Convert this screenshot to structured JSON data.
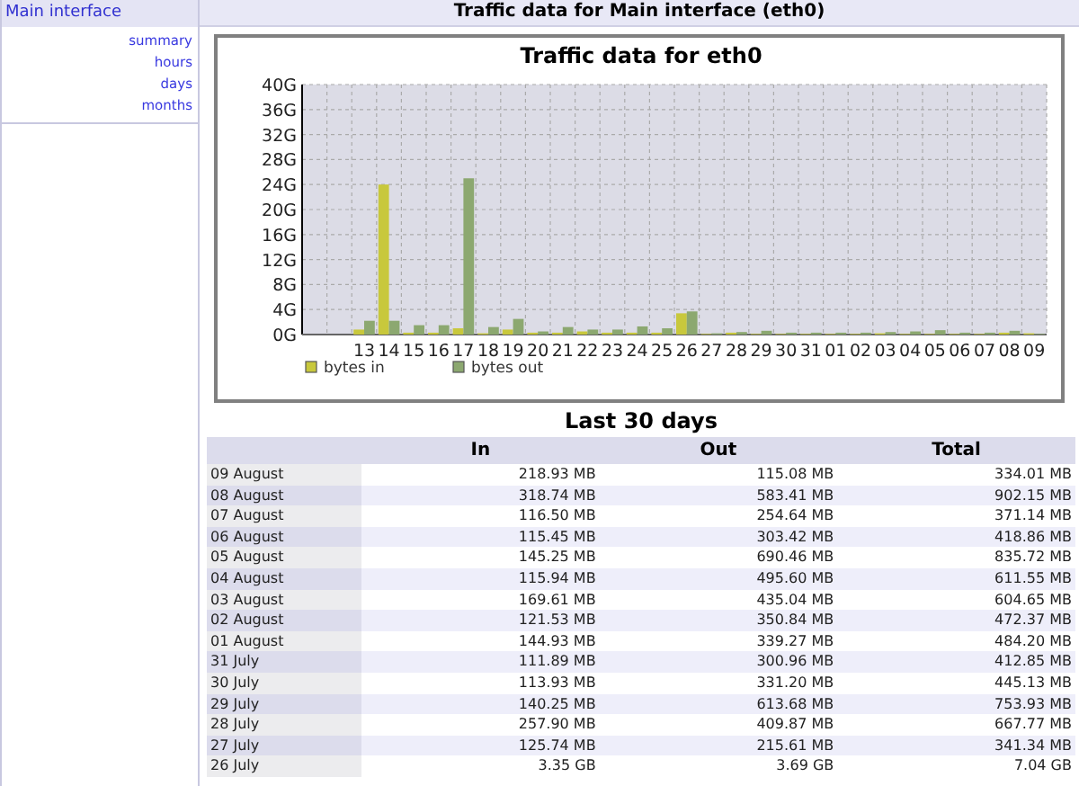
{
  "sidebar": {
    "title": "Main interface",
    "items": [
      {
        "label": "summary"
      },
      {
        "label": "hours"
      },
      {
        "label": "days"
      },
      {
        "label": "months"
      }
    ]
  },
  "page_title": "Traffic data for Main interface (eth0)",
  "chart": {
    "chart_data": {
      "type": "bar",
      "title": "Traffic data for eth0",
      "categories": [
        "13",
        "14",
        "15",
        "16",
        "17",
        "18",
        "19",
        "20",
        "21",
        "22",
        "23",
        "24",
        "25",
        "26",
        "27",
        "28",
        "29",
        "30",
        "31",
        "01",
        "02",
        "03",
        "04",
        "05",
        "06",
        "07",
        "08",
        "09"
      ],
      "series": [
        {
          "name": "bytes in",
          "color": "#c8c83c",
          "values": [
            0.8,
            24,
            0.3,
            0.3,
            1,
            0.2,
            0.8,
            0.3,
            0.3,
            0.5,
            0.3,
            0.3,
            0.3,
            3.4,
            0.1,
            0.3,
            0.1,
            0.1,
            0.1,
            0.1,
            0.1,
            0.2,
            0.1,
            0.1,
            0.1,
            0.1,
            0.3,
            0.2
          ]
        },
        {
          "name": "bytes out",
          "color": "#8ca870",
          "values": [
            2.2,
            2.2,
            1.5,
            1.5,
            25,
            1.2,
            2.5,
            0.5,
            1.2,
            0.8,
            0.8,
            1.3,
            1,
            3.7,
            0.2,
            0.4,
            0.6,
            0.3,
            0.3,
            0.3,
            0.3,
            0.4,
            0.5,
            0.7,
            0.3,
            0.3,
            0.6,
            0.1
          ]
        }
      ],
      "ylim": [
        0,
        40
      ],
      "yticks": [
        {
          "value": 0,
          "label": "0G"
        },
        {
          "value": 4,
          "label": "4G"
        },
        {
          "value": 8,
          "label": "8G"
        },
        {
          "value": 12,
          "label": "12G"
        },
        {
          "value": 16,
          "label": "16G"
        },
        {
          "value": 20,
          "label": "20G"
        },
        {
          "value": 24,
          "label": "24G"
        },
        {
          "value": 28,
          "label": "28G"
        },
        {
          "value": 32,
          "label": "32G"
        },
        {
          "value": 36,
          "label": "36G"
        },
        {
          "value": 40,
          "label": "40G"
        }
      ],
      "stacked": false,
      "orientation": "vertical",
      "grid": true,
      "legend": "lower left"
    }
  },
  "table": {
    "title": "Last 30 days",
    "columns": [
      "In",
      "Out",
      "Total"
    ],
    "rows": [
      {
        "day": "09 August",
        "in": "218.93 MB",
        "out": "115.08 MB",
        "total": "334.01 MB"
      },
      {
        "day": "08 August",
        "in": "318.74 MB",
        "out": "583.41 MB",
        "total": "902.15 MB"
      },
      {
        "day": "07 August",
        "in": "116.50 MB",
        "out": "254.64 MB",
        "total": "371.14 MB"
      },
      {
        "day": "06 August",
        "in": "115.45 MB",
        "out": "303.42 MB",
        "total": "418.86 MB"
      },
      {
        "day": "05 August",
        "in": "145.25 MB",
        "out": "690.46 MB",
        "total": "835.72 MB"
      },
      {
        "day": "04 August",
        "in": "115.94 MB",
        "out": "495.60 MB",
        "total": "611.55 MB"
      },
      {
        "day": "03 August",
        "in": "169.61 MB",
        "out": "435.04 MB",
        "total": "604.65 MB"
      },
      {
        "day": "02 August",
        "in": "121.53 MB",
        "out": "350.84 MB",
        "total": "472.37 MB"
      },
      {
        "day": "01 August",
        "in": "144.93 MB",
        "out": "339.27 MB",
        "total": "484.20 MB"
      },
      {
        "day": "31 July",
        "in": "111.89 MB",
        "out": "300.96 MB",
        "total": "412.85 MB"
      },
      {
        "day": "30 July",
        "in": "113.93 MB",
        "out": "331.20 MB",
        "total": "445.13 MB"
      },
      {
        "day": "29 July",
        "in": "140.25 MB",
        "out": "613.68 MB",
        "total": "753.93 MB"
      },
      {
        "day": "28 July",
        "in": "257.90 MB",
        "out": "409.87 MB",
        "total": "667.77 MB"
      },
      {
        "day": "27 July",
        "in": "125.74 MB",
        "out": "215.61 MB",
        "total": "341.34 MB"
      },
      {
        "day": "26 July",
        "in": "3.35 GB",
        "out": "3.69 GB",
        "total": "7.04 GB"
      }
    ]
  }
}
